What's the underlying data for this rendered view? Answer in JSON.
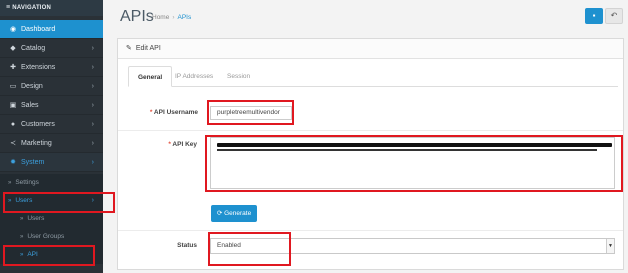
{
  "sidebar": {
    "header": "NAVIGATION",
    "items": [
      {
        "label": "Dashboard",
        "icon": "dashboard-icon",
        "glyph": "◉"
      },
      {
        "label": "Catalog",
        "icon": "tag-icon",
        "glyph": "◆"
      },
      {
        "label": "Extensions",
        "icon": "puzzle-icon",
        "glyph": "✚"
      },
      {
        "label": "Design",
        "icon": "monitor-icon",
        "glyph": "▭"
      },
      {
        "label": "Sales",
        "icon": "cart-icon",
        "glyph": "▣"
      },
      {
        "label": "Customers",
        "icon": "user-icon",
        "glyph": "●"
      },
      {
        "label": "Marketing",
        "icon": "share-icon",
        "glyph": "≺"
      },
      {
        "label": "System",
        "icon": "cog-icon",
        "glyph": "✹"
      }
    ],
    "sub": {
      "settings": "Settings",
      "users": "Users",
      "users_child": "Users",
      "user_groups": "User Groups",
      "api": "API"
    },
    "chevron": "›"
  },
  "header": {
    "title": "APIs",
    "breadcrumb": [
      "Home",
      "APIs"
    ],
    "separator": "›"
  },
  "toolbar": {
    "save_glyph": "▪",
    "back_glyph": "↶"
  },
  "panel": {
    "heading": "Edit API",
    "tabs": [
      "General",
      "IP Addresses",
      "Session"
    ]
  },
  "form": {
    "username_label": "API Username",
    "username_value": "purpletreemultivendor",
    "key_label": "API Key",
    "generate_label": "Generate",
    "generate_glyph": "⟳",
    "status_label": "Status",
    "status_value": "Enabled"
  },
  "colors": {
    "sidebar_bg": "#2a3137",
    "accent": "#1e91cf",
    "annotation": "#e01820",
    "required": "#e3503e"
  }
}
